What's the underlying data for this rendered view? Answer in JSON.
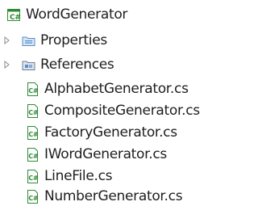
{
  "solution_explorer": {
    "project": {
      "label": "WordGenerator",
      "icon": "csharp-project-icon"
    },
    "folders": [
      {
        "label": "Properties",
        "icon": "properties-folder-icon",
        "expanded": false
      },
      {
        "label": "References",
        "icon": "references-folder-icon",
        "expanded": false
      }
    ],
    "files": [
      {
        "label": "AlphabetGenerator.cs",
        "icon": "csharp-file-icon"
      },
      {
        "label": "CompositeGenerator.cs",
        "icon": "csharp-file-icon"
      },
      {
        "label": "FactoryGenerator.cs",
        "icon": "csharp-file-icon"
      },
      {
        "label": "IWordGenerator.cs",
        "icon": "csharp-file-icon"
      },
      {
        "label": "LineFile.cs",
        "icon": "csharp-file-icon"
      },
      {
        "label": "NumberGenerator.cs",
        "icon": "csharp-file-icon"
      }
    ],
    "colors": {
      "csharp_green": "#2e8b34",
      "folder_blue": "#5a8fc8",
      "text": "#1e1e1e",
      "expander": "#8a8a8a"
    }
  }
}
